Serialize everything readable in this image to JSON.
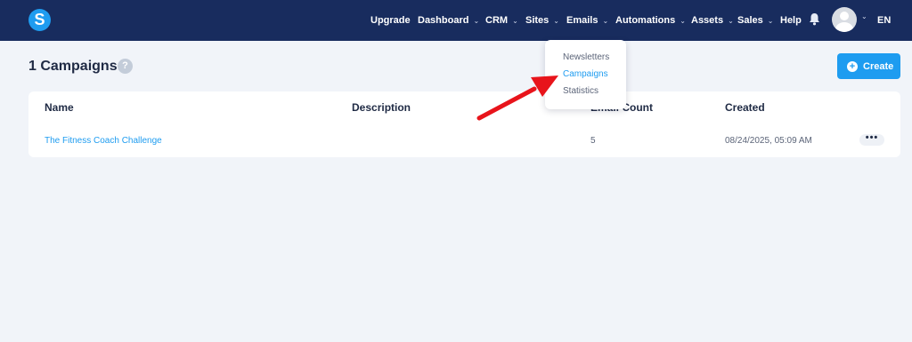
{
  "logo": {
    "letter": "S"
  },
  "nav": [
    {
      "label": "Upgrade",
      "dropdown": false
    },
    {
      "label": "Dashboard",
      "dropdown": true
    },
    {
      "label": "CRM",
      "dropdown": true
    },
    {
      "label": "Sites",
      "dropdown": true
    },
    {
      "label": "Emails",
      "dropdown": true
    },
    {
      "label": "Automations",
      "dropdown": true
    },
    {
      "label": "Assets",
      "dropdown": true
    },
    {
      "label": "Sales",
      "dropdown": true
    },
    {
      "label": "Help",
      "dropdown": false
    }
  ],
  "language": "EN",
  "page": {
    "title": "1 Campaigns",
    "help": "?",
    "create_label": "Create"
  },
  "table": {
    "columns": [
      "Name",
      "Description",
      "Email Count",
      "Created"
    ],
    "rows": [
      {
        "name": "The Fitness Coach Challenge",
        "description": "",
        "email_count": "5",
        "created": "08/24/2025, 05:09 AM"
      }
    ]
  },
  "emails_menu": {
    "items": [
      "Newsletters",
      "Campaigns",
      "Statistics"
    ],
    "active": "Campaigns"
  },
  "colors": {
    "topbar": "#182c5e",
    "accent": "#1e9cf0",
    "annotation_arrow": "#e8141b"
  }
}
